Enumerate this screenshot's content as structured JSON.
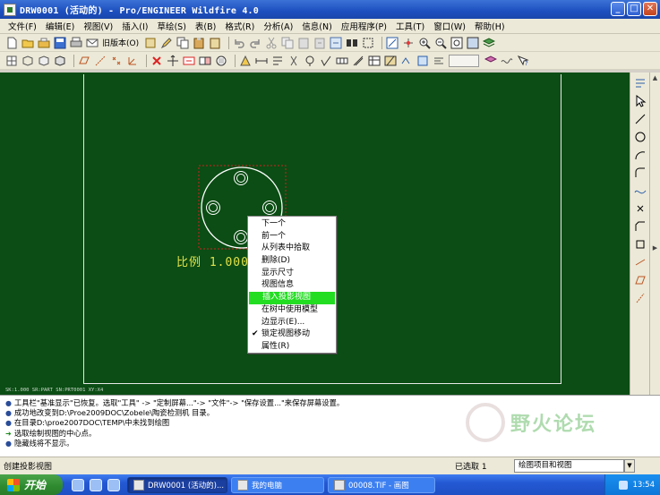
{
  "window": {
    "title": "DRW0001 (活动的) - Pro/ENGINEER Wildfire 4.0"
  },
  "menu": [
    "文件(F)",
    "编辑(E)",
    "视图(V)",
    "插入(I)",
    "草绘(S)",
    "表(B)",
    "格式(R)",
    "分析(A)",
    "信息(N)",
    "应用程序(P)",
    "工具(T)",
    "窗口(W)",
    "帮助(H)"
  ],
  "toolbar": {
    "legacy_label": "旧版本(O)"
  },
  "drawing": {
    "scale_label": "比例 1.000",
    "coord_readout": "SK:1.000  SR:PART  SN:PRT0001  XY:X4"
  },
  "context_menu": {
    "items": [
      {
        "label": "下一个",
        "checked": false,
        "highlighted": false
      },
      {
        "label": "前一个",
        "checked": false,
        "highlighted": false
      },
      {
        "label": "从列表中拾取",
        "checked": false,
        "highlighted": false
      },
      {
        "label": "删除(D)",
        "checked": false,
        "highlighted": false
      },
      {
        "label": "显示尺寸",
        "checked": false,
        "highlighted": false
      },
      {
        "label": "视图信息",
        "checked": false,
        "highlighted": false
      },
      {
        "label": "插入投影视图",
        "checked": false,
        "highlighted": true
      },
      {
        "label": "在树中使用模型",
        "checked": false,
        "highlighted": false
      },
      {
        "label": "边显示(E)...",
        "checked": false,
        "highlighted": false
      },
      {
        "label": "锁定视图移动",
        "checked": true,
        "highlighted": false
      },
      {
        "label": "属性(R)",
        "checked": false,
        "highlighted": false
      }
    ]
  },
  "messages": [
    {
      "type": "info",
      "text": "工具栏\"基准显示\"已恢复。选取\"工具\" -> \"定制屏幕...\"-> \"文件\"-> \"保存设置...\"来保存屏幕设置。"
    },
    {
      "type": "info",
      "text": "成功地改变到D:\\Proe2009DOC\\Zobele\\陶瓷检测机 目录。"
    },
    {
      "type": "info",
      "text": "在目录D:\\proe2007DOC\\TEMP\\中未找到绘图"
    },
    {
      "type": "prompt",
      "text": "选取绘制视图的中心点。"
    },
    {
      "type": "info",
      "text": "隐藏线将不显示。"
    }
  ],
  "watermark": {
    "text": "野火论坛"
  },
  "status": {
    "left": "创建投影视图",
    "selected": "已选取 1",
    "filter_value": "绘图项目和视图"
  },
  "taskbar": {
    "start_label": "开始",
    "tasks": [
      {
        "label": "DRW0001 (活动的)...",
        "active": true
      },
      {
        "label": "我的电脑",
        "active": false
      },
      {
        "label": "00008.TIF - 画图",
        "active": false
      }
    ],
    "clock": "13:54"
  },
  "colors": {
    "canvas": "#0b4d14",
    "highlight": "#22dd22",
    "scale_text": "#e2e24a",
    "selection_box": "#d02020"
  }
}
